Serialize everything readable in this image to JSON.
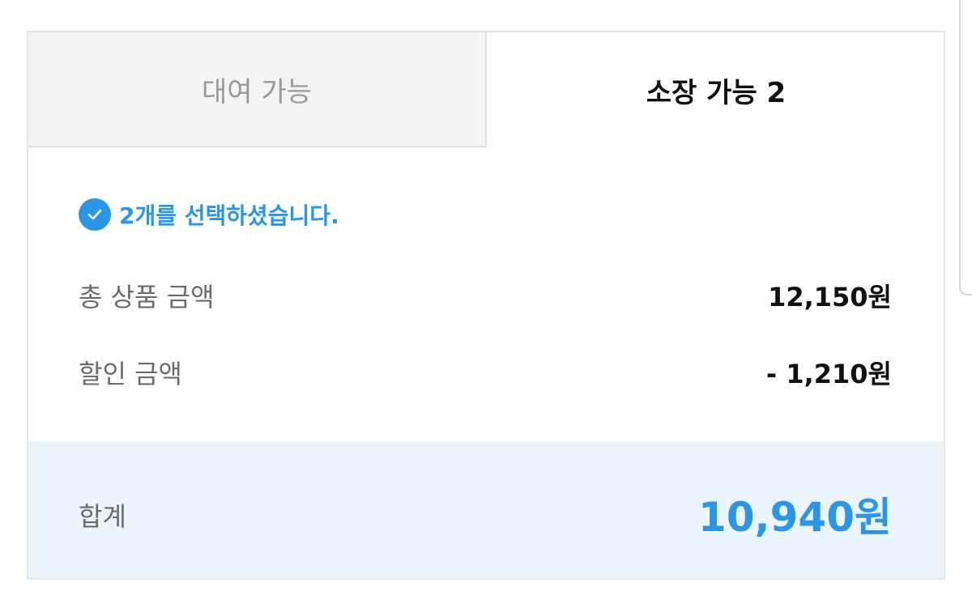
{
  "tabs": [
    {
      "label": "대여 가능",
      "active": false
    },
    {
      "label": "소장 가능 2",
      "active": true
    }
  ],
  "selection": {
    "icon": "check-circle-icon",
    "message": "2개를 선택하셨습니다."
  },
  "summary": {
    "total_price_label": "총 상품 금액",
    "total_price_value": "12,150원",
    "discount_label": "할인 금액",
    "discount_value": "- 1,210원"
  },
  "total": {
    "label": "합계",
    "value": "10,940원"
  },
  "colors": {
    "accent": "#2b96e8",
    "total_bg": "#eaf5fd",
    "inactive_tab_bg": "#f4f4f4"
  }
}
